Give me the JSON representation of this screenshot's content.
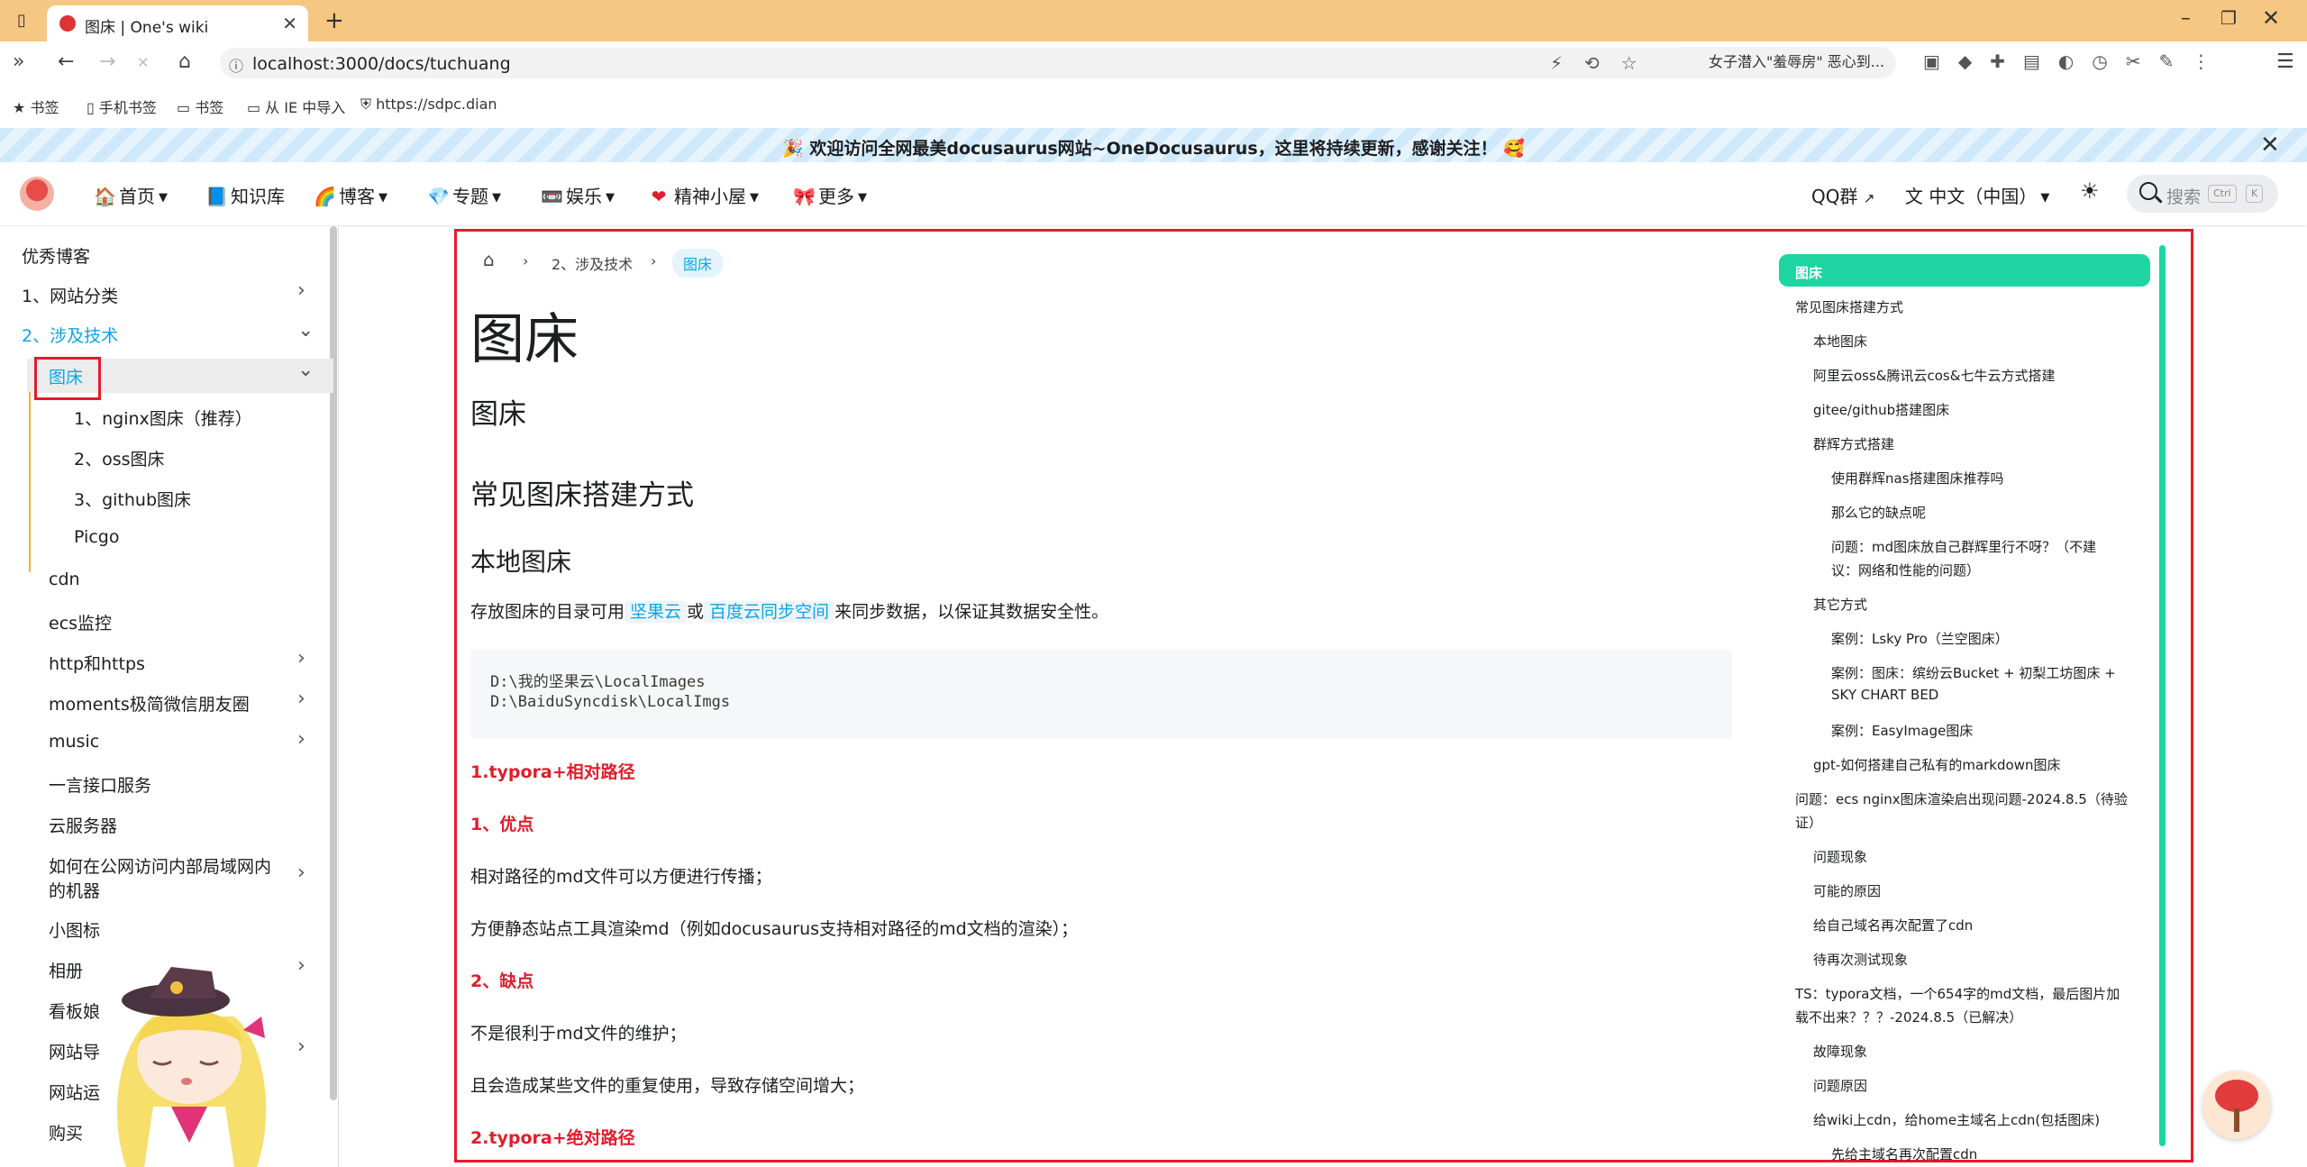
{
  "browser": {
    "tab_title": "图床 | One's wiki",
    "url": "localhost:3000/docs/tuchuang",
    "news_text": "女子潜入\"羞辱房\" 恶心到...",
    "bookmarks": [
      "书签",
      "手机书签",
      "书签",
      "从 IE 中导入",
      "https://sdpc.dian"
    ]
  },
  "announcement": {
    "text": "🎉 欢迎访问全网最美docusaurus网站~OneDocusaurus，这里将持续更新，感谢关注！ 🥰"
  },
  "navbar": {
    "items": [
      {
        "icon": "🏠",
        "label": "首页"
      },
      {
        "icon": "📘",
        "label": "知识库"
      },
      {
        "icon": "🌈",
        "label": "博客"
      },
      {
        "icon": "💎",
        "label": "专题"
      },
      {
        "icon": "📼",
        "label": "娱乐"
      },
      {
        "icon": "❤",
        "label": "精神小屋"
      },
      {
        "icon": "🎀",
        "label": "更多"
      }
    ],
    "qq_label": "QQ群",
    "lang_label": "中文（中国）",
    "search_placeholder": "搜索",
    "search_key1": "Ctrl",
    "search_key2": "K"
  },
  "sidebar": {
    "items": [
      "优秀博客",
      "1、网站分类",
      "2、涉及技术",
      "图床",
      "1、nginx图床（推荐）",
      "2、oss图床",
      "3、github图床",
      "Picgo",
      "cdn",
      "ecs监控",
      "http和https",
      "moments极简微信朋友圈",
      "music",
      "一言接口服务",
      "云服务器",
      "如何在公网访问内部局域网内",
      "的机器",
      "小图标",
      "相册",
      "看板娘",
      "网站导",
      "网站运",
      "购买"
    ]
  },
  "doc": {
    "breadcrumb_1": "2、涉及技术",
    "breadcrumb_2": "图床",
    "h1": "图床",
    "h2_1": "图床",
    "h2_2": "常见图床搭建方式",
    "h3_1": "本地图床",
    "p1_a": "存放图床的目录可用",
    "p1_code1": "坚果云",
    "p1_b": "或",
    "p1_code2": "百度云同步空间",
    "p1_c": "来同步数据，以保证其数据安全性。",
    "code_1": "D:\\我的坚果云\\LocalImages",
    "code_2": "D:\\BaiduSyncdisk\\LocalImgs",
    "red_1": "1.typora+相对路径",
    "red_2": "1、优点",
    "p2": "相对路径的md文件可以方便进行传播；",
    "p3": "方便静态站点工具渲染md（例如docusaurus支持相对路径的md文档的渲染）；",
    "red_3": "2、缺点",
    "p4": "不是很利于md文件的维护；",
    "p5": "且会造成某些文件的重复使用，导致存储空间增大；",
    "red_4": "2.typora+绝对路径"
  },
  "toc": [
    "图床",
    "常见图床搭建方式",
    "本地图床",
    "阿里云oss&腾讯云cos&七牛云方式搭建",
    "gitee/github搭建图床",
    "群辉方式搭建",
    "使用群辉nas搭建图床推荐吗",
    "那么它的缺点呢",
    "问题：md图床放自己群辉里行不呀？（不建",
    "议：网络和性能的问题）",
    "其它方式",
    "案例：Lsky Pro（兰空图床）",
    "案例：图床：缤纷云Bucket + 初梨工坊图床 +",
    "SKY CHART BED",
    "案例：EasyImage图床",
    "gpt-如何搭建自己私有的markdown图床",
    "问题：ecs nginx图床渲染启出现问题-2024.8.5（待验",
    "证）",
    "问题现象",
    "可能的原因",
    "给自己域名再次配置了cdn",
    "待再次测试现象",
    "TS：typora文档，一个654字的md文档，最后图片加",
    "载不出来？？？-2024.8.5（已解决）",
    "故障现象",
    "问题原因",
    "给wiki上cdn，给home主域名上cdn(包括图床)",
    "先给主域名再次配置cdn"
  ]
}
